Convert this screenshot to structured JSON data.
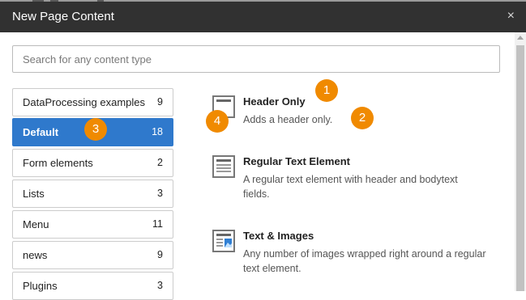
{
  "dialog": {
    "title": "New Page Content",
    "close_glyph": "×"
  },
  "search": {
    "placeholder": "Search for any content type"
  },
  "categories": [
    {
      "label": "DataProcessing examples",
      "count": "9"
    },
    {
      "label": "Default",
      "count": "18",
      "active": true
    },
    {
      "label": "Form elements",
      "count": "2"
    },
    {
      "label": "Lists",
      "count": "3"
    },
    {
      "label": "Menu",
      "count": "11"
    },
    {
      "label": "news",
      "count": "9"
    },
    {
      "label": "Plugins",
      "count": "3"
    }
  ],
  "content_types": [
    {
      "name": "Header Only",
      "description": "Adds a header only.",
      "icon": "header-only-icon"
    },
    {
      "name": "Regular Text Element",
      "description": "A regular text element with header and bodytext fields.",
      "icon": "text-element-icon"
    },
    {
      "name": "Text & Images",
      "description": "Any number of images wrapped right around a regular text element.",
      "icon": "text-images-icon"
    }
  ],
  "annotations": [
    "1",
    "2",
    "3",
    "4"
  ],
  "colors": {
    "titlebar": "#313131",
    "active_category": "#2f79cc",
    "annotation_badge": "#f08a00"
  }
}
